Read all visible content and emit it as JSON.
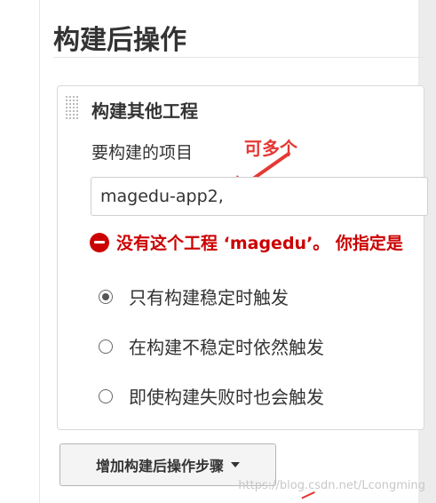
{
  "section": {
    "title": "构建后操作"
  },
  "panel": {
    "title": "构建其他工程",
    "field_label": "要构建的项目",
    "input_value": "magedu-app2,",
    "annotation": "可多个",
    "error": "没有这个工程 ‘magedu’。 你指定是"
  },
  "trigger_options": [
    {
      "label": "只有构建稳定时触发",
      "selected": true
    },
    {
      "label": "在构建不稳定时依然触发",
      "selected": false
    },
    {
      "label": "即使构建失败时也会触发",
      "selected": false
    }
  ],
  "add_step_button": {
    "label": "增加构建后操作步骤"
  },
  "watermark": "https://blog.csdn.net/Lcongming",
  "colors": {
    "error": "#cc0000",
    "annotation": "#e53935"
  },
  "icons": {
    "error": "error-icon",
    "arrow": "annotation-arrow-icon",
    "dropdown": "caret-down-icon",
    "drag": "drag-handle-icon"
  }
}
